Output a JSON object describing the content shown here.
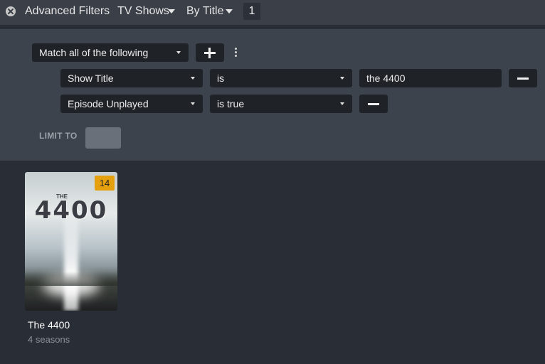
{
  "topbar": {
    "title": "Advanced Filters",
    "library_type": "TV Shows",
    "sort": "By Title",
    "result_count": "1"
  },
  "filter": {
    "match_mode": "Match all of the following",
    "rules": [
      {
        "field": "Show Title",
        "operator": "is",
        "value": "the 4400"
      },
      {
        "field": "Episode Unplayed",
        "operator": "is true",
        "value": ""
      }
    ],
    "limit_label": "LIMIT TO",
    "limit_value": ""
  },
  "library": {
    "items": [
      {
        "title": "The 4400",
        "subtitle": "4 seasons",
        "unwatched_count": "14",
        "poster_art": "4400",
        "poster_small_art": "THE"
      }
    ]
  },
  "colors": {
    "background": "#282d36",
    "panel": "#3d434c",
    "topbar": "#3a3f48",
    "accent": "#e5a00d",
    "control": "#1f2328"
  },
  "icons": {
    "close": "close-icon",
    "add": "plus-icon",
    "remove": "minus-icon",
    "more": "kebab-icon"
  }
}
